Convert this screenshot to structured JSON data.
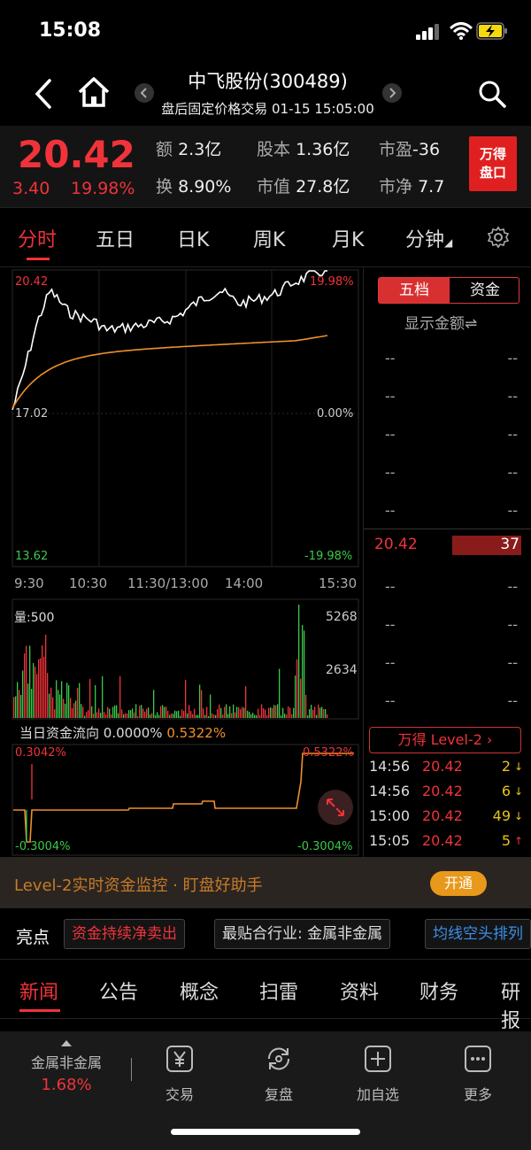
{
  "status": {
    "time": "15:08"
  },
  "nav": {
    "title": "中飞股份(300489)",
    "subtitle": "盘后固定价格交易 01-15 15:05:00"
  },
  "quote": {
    "price": "20.42",
    "change": "3.40",
    "change_pct": "19.98%",
    "stats": [
      {
        "k": "额",
        "v": "2.3亿"
      },
      {
        "k": "股本",
        "v": "1.36亿"
      },
      {
        "k": "市盈",
        "v": "-36"
      },
      {
        "k": "换",
        "v": "8.90%"
      },
      {
        "k": "市值",
        "v": "27.8亿"
      },
      {
        "k": "市净",
        "v": "7.7"
      }
    ],
    "wind_btn_l1": "万得",
    "wind_btn_l2": "盘口"
  },
  "tabs": [
    "分时",
    "五日",
    "日K",
    "周K",
    "月K",
    "分钟"
  ],
  "chart": {
    "price_top": "20.42",
    "pct_top": "19.98%",
    "price_mid": "17.02",
    "pct_mid": "0.00%",
    "price_bot": "13.62",
    "pct_bot": "-19.98%",
    "times": [
      "9:30",
      "10:30",
      "11:30/13:00",
      "14:00",
      "15:30"
    ],
    "vol_label": "量:500",
    "vol_max": "5268",
    "vol_mid": "2634",
    "flow_title": "当日资金流向",
    "flow_v1": "0.0000%",
    "flow_v2": "0.5322%",
    "flow_top_left": "0.3042%",
    "flow_top_right": "0.5322%",
    "flow_bot_left": "-0.3004%",
    "flow_bot_right": "-0.3004%"
  },
  "book": {
    "seg_a": "五档",
    "seg_b": "资金",
    "show_amount": "显示金额⇌",
    "dash": "--",
    "bid_price": "20.42",
    "bid_vol": "37",
    "level2": "万得 Level-2 ›",
    "trades": [
      {
        "t": "14:56",
        "p": "20.42",
        "v": "2",
        "dir": "↓",
        "color": "#e8c21a"
      },
      {
        "t": "14:56",
        "p": "20.42",
        "v": "6",
        "dir": "↓",
        "color": "#e8c21a"
      },
      {
        "t": "15:00",
        "p": "20.42",
        "v": "49",
        "dir": "↓",
        "color": "#e8c21a"
      },
      {
        "t": "15:05",
        "p": "20.42",
        "v": "5",
        "dir": "↑",
        "color": "#f0333a"
      }
    ]
  },
  "banner": {
    "text": "Level-2实时资金监控 · 盯盘好助手",
    "btn": "开通"
  },
  "highlights": {
    "title": "亮点",
    "chips": [
      "资金持续净卖出",
      "最贴合行业: 金属非金属",
      "均线空头排列"
    ]
  },
  "news_tabs": [
    "新闻",
    "公告",
    "概念",
    "扫雷",
    "资料",
    "财务",
    "研报"
  ],
  "bottom": {
    "sector": "金属非金属",
    "sector_pct": "1.68%",
    "actions": [
      "交易",
      "复盘",
      "加自选",
      "更多"
    ]
  },
  "colors": {
    "up": "#f0333a",
    "down": "#3cc94a",
    "avg": "#f0902a"
  }
}
